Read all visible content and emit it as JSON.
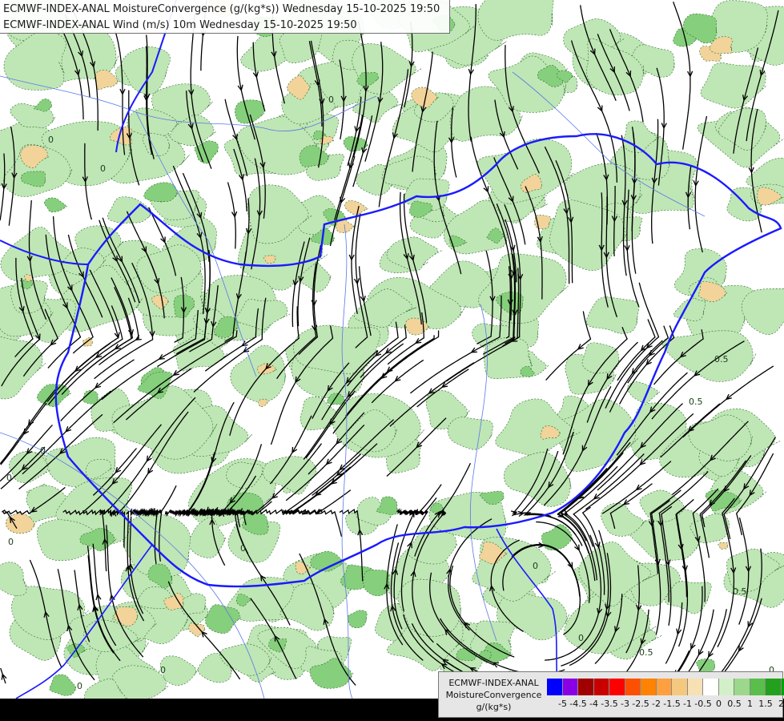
{
  "header": {
    "line1": "ECMWF-INDEX-ANAL MoistureConvergence (g/(kg*s)) Wednesday 15-10-2025 19:50",
    "line2": "ECMWF-INDEX-ANAL Wind (m/s) 10m Wednesday 15-10-2025 19:50"
  },
  "map": {
    "contour_labels": [
      "0",
      "0",
      "0",
      "0",
      "0.5",
      "0",
      "0",
      "0",
      "0",
      "0.5",
      "0.5",
      "0.5",
      "0",
      "0",
      "0",
      "0"
    ],
    "colors": {
      "convergence_light": "#bfe6b5",
      "convergence_mid": "#86cf7c",
      "divergence_light": "#f2d39a",
      "border": "#1a1aff",
      "river": "#5a78e6",
      "streamline": "#000000"
    }
  },
  "legend": {
    "line1": "ECMWF-INDEX-ANAL",
    "line2": "MoistureConvergence",
    "line3": "g/(kg*s)",
    "colors": [
      "#0000ff",
      "#8a00e6",
      "#a00000",
      "#c80000",
      "#ff0000",
      "#ff5000",
      "#ff8200",
      "#ffa040",
      "#f5c880",
      "#f7e1b4",
      "#ffffff",
      "#d2f0c8",
      "#9bd88c",
      "#5abe4b",
      "#23a01e",
      "#00a000"
    ],
    "ticks": [
      "-5",
      "-4.5",
      "-4",
      "-3.5",
      "-3",
      "-2.5",
      "-2",
      "-1.5",
      "-1",
      "-0.5",
      "0",
      "0.5",
      "1",
      "1.5",
      "2"
    ]
  }
}
